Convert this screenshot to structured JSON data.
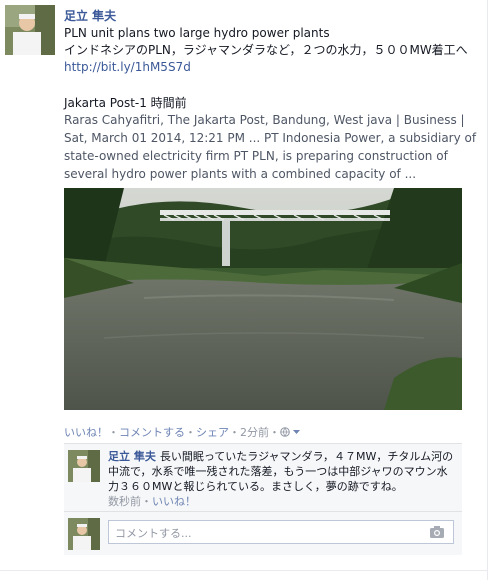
{
  "post": {
    "author": "足立 隼夫",
    "line1": "PLN unit plans two large hydro power plants",
    "line2": "インドネシアのPLN，ラジャマンダラなど，２つの水力，５００MW着工へ",
    "link": "http://bit.ly/1hM5S7d",
    "source": "Jakarta Post-1 時間前",
    "summary": "Raras Cahyafitri, The Jakarta Post, Bandung, West java | Business | Sat, March 01 2014, 12:21 PM ... PT Indonesia Power, a subsidiary of state-owned electricity firm PT PLN, is preparing construction of several hydro power plants with a combined capacity of ..."
  },
  "actions": {
    "like": "いいね！",
    "comment": "コメントする",
    "share": "シェア",
    "time": "2分前",
    "dot": "・"
  },
  "comment": {
    "author": "足立 隼夫",
    "text": "長い間眠っていたラジャマンダラ，４７MW，チタルム河の中流で，水系で唯一残された落差，もう一つは中部ジャワのマウン水力３６０MWと報じられている。まさしく，夢の跡ですね。",
    "time": "数秒前",
    "like": "いいね！"
  },
  "reply": {
    "placeholder": "コメントする..."
  },
  "icons": {
    "privacy": "globe-icon",
    "dropdown": "chevron-down-icon",
    "camera": "camera-icon"
  },
  "colors": {
    "link": "#3b5998",
    "meta": "#9197a3",
    "comment_bg": "#f6f7f8"
  }
}
